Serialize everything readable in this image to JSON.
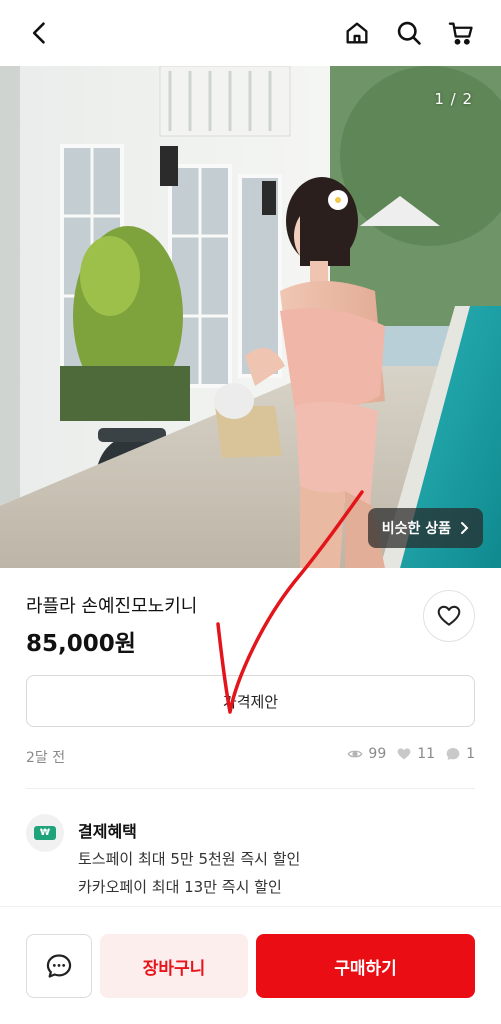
{
  "header": {
    "back_icon": "chevron-left-icon",
    "home_icon": "home-icon",
    "search_icon": "search-icon",
    "cart_icon": "cart-icon"
  },
  "photo": {
    "counter": "1 / 2",
    "similar_label": "비슷한 상품"
  },
  "product": {
    "title": "라플라 손예진모노키니",
    "price": "85,000원"
  },
  "offer": {
    "label": "가격제안"
  },
  "meta": {
    "time": "2달 전",
    "views": "99",
    "likes": "11",
    "chats": "1"
  },
  "benefit": {
    "title": "결제혜택",
    "lines": [
      "토스페이 최대 5만 5천원 즉시 할인",
      "카카오페이 최대 13만 즉시 할인"
    ],
    "chip": "₩"
  },
  "bottom": {
    "cart_label": "장바구니",
    "buy_label": "구매하기"
  },
  "colors": {
    "accent": "#ea0d14",
    "cart_bg": "#fdeeee",
    "annotation": "#e3151b"
  }
}
